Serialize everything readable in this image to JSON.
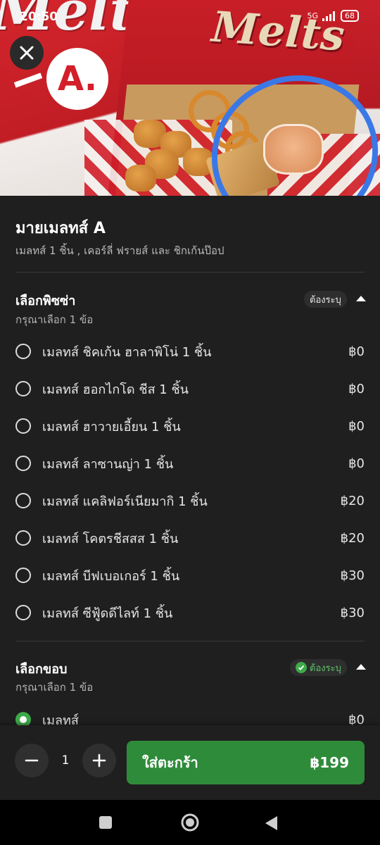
{
  "status_bar": {
    "time": "20:50",
    "network": "5G",
    "battery": "68"
  },
  "product": {
    "title": "มายเมลทส์ A",
    "description": "เมลทส์ 1 ชิ้น , เคอร์ลี่ ฟรายส์ และ ชิกเก้นป๊อป",
    "hero_logo_text": "A."
  },
  "sections": [
    {
      "title": "เลือกพิซซ่า",
      "hint": "กรุณาเลือก 1 ข้อ",
      "badge": "ต้องระบุ",
      "options": [
        {
          "label": "เมลทส์ ชิคเก้น ฮาลาพิโน่ 1 ชิ้น",
          "price": "฿0"
        },
        {
          "label": "เมลทส์ ฮอกไกโด ชีส 1 ชิ้น",
          "price": "฿0"
        },
        {
          "label": "เมลทส์ ฮาวายเอี้ยน 1 ชิ้น",
          "price": "฿0"
        },
        {
          "label": "เมลทส์ ลาซานญ่า 1 ชิ้น",
          "price": "฿0"
        },
        {
          "label": "เมลทส์ แคลิฟอร์เนียมากิ 1 ชิ้น",
          "price": "฿20"
        },
        {
          "label": "เมลทส์ โคตรชีสสส 1 ชิ้น",
          "price": "฿20"
        },
        {
          "label": "เมลทส์ บีฟเบอเกอร์ 1 ชิ้น",
          "price": "฿30"
        },
        {
          "label": "เมลทส์ ซีฟู้ดดีไลท์ 1 ชิ้น",
          "price": "฿30"
        }
      ]
    },
    {
      "title": "เลือกขอบ",
      "hint": "กรุณาเลือก 1 ข้อ",
      "badge": "ต้องระบุ",
      "options": [
        {
          "label": "เมลทส์",
          "price": "฿0",
          "selected": true
        }
      ]
    }
  ],
  "cart": {
    "quantity": "1",
    "button_label": "ใส่ตะกร้า",
    "total": "฿199"
  },
  "colors": {
    "accent": "#2e8b3a",
    "selected_radio": "#3daa48",
    "background": "#1f1f1f",
    "annotation_circle": "#3b78e7"
  }
}
